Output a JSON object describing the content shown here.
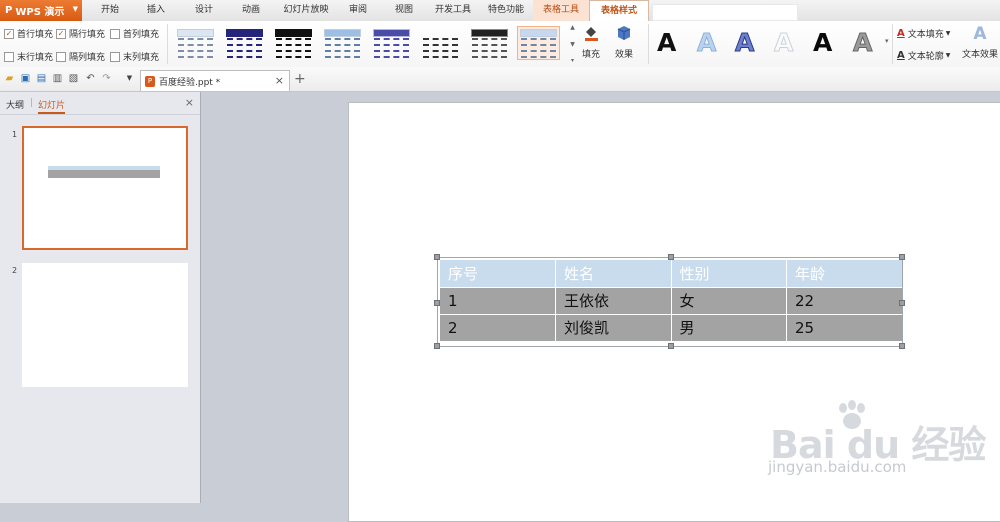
{
  "app": {
    "name": "WPS 演示"
  },
  "ribbon_tabs": [
    {
      "label": "开始"
    },
    {
      "label": "插入"
    },
    {
      "label": "设计"
    },
    {
      "label": "动画"
    },
    {
      "label": "幻灯片放映"
    },
    {
      "label": "审阅"
    },
    {
      "label": "视图"
    },
    {
      "label": "开发工具"
    },
    {
      "label": "特色功能"
    },
    {
      "label": "表格工具"
    },
    {
      "label": "表格样式"
    }
  ],
  "active_tab": "表格样式",
  "options": [
    {
      "label": "首行填充",
      "checked": true
    },
    {
      "label": "隔行填充",
      "checked": true
    },
    {
      "label": "首列填充",
      "checked": false
    },
    {
      "label": "末行填充",
      "checked": false
    },
    {
      "label": "隔列填充",
      "checked": false
    },
    {
      "label": "末列填充",
      "checked": false
    }
  ],
  "gallery_selected_index": 8,
  "buttons": {
    "fill": "填充",
    "effect": "效果"
  },
  "text_tools": {
    "text_fill": "文本填充",
    "text_outline": "文本轮廓",
    "text_effect": "文本效果"
  },
  "document": {
    "tab_title": "百度经验.ppt *"
  },
  "panel": {
    "tab_outline": "大纲",
    "tab_slides": "幻灯片"
  },
  "slides": [
    {
      "number": "1"
    },
    {
      "number": "2"
    }
  ],
  "table": {
    "headers": [
      "序号",
      "姓名",
      "性别",
      "年龄"
    ],
    "rows": [
      [
        "1",
        "王依依",
        "女",
        "22"
      ],
      [
        "2",
        "刘俊凯",
        "男",
        "25"
      ]
    ]
  },
  "watermark": {
    "text": "Bai du 经验",
    "url": "jingyan.baidu.com"
  },
  "colors": {
    "accent": "#d9581b",
    "header_fill": "#c9dcee",
    "row_fill": "#a3a3a3"
  }
}
